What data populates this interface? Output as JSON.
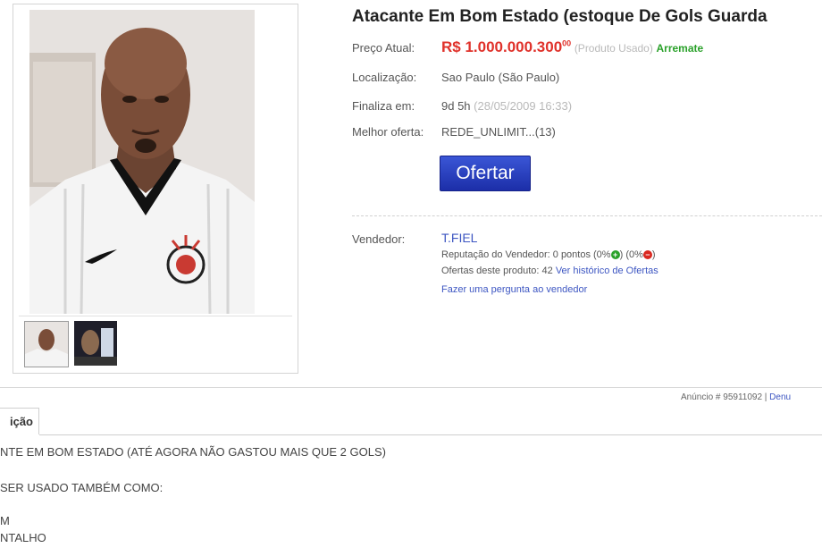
{
  "listing": {
    "title": "Atacante Em Bom Estado (estoque De Gols Guarda",
    "price_label": "Preço Atual:",
    "price": "R$ 1.000.000.300",
    "price_cents": "00",
    "condition": "(Produto Usado)",
    "auction_tag": "Arremate",
    "location_label": "Localização:",
    "location": "Sao Paulo (São Paulo)",
    "ends_label": "Finaliza em:",
    "ends_in": "9d 5h",
    "ends_date": "(28/05/2009 16:33)",
    "best_offer_label": "Melhor oferta:",
    "best_offer": "REDE_UNLIMIT...(13)",
    "offer_button": "Ofertar"
  },
  "seller": {
    "label": "Vendedor:",
    "name": "T.FIEL",
    "reputation_text": "Reputação do Vendedor: 0 pontos (0%",
    "reputation_mid": ")  (0%",
    "reputation_end": ")",
    "positive_icon": "plus-icon",
    "negative_icon": "minus-icon",
    "offers_text": "Ofertas deste produto: 42",
    "offers_link": "Ver histórico de Ofertas",
    "ask_link": "Fazer uma pergunta ao vendedor"
  },
  "ad": {
    "id_text": "Anúncio # 95911092 |",
    "report_link": "Denu"
  },
  "description": {
    "tab_label": "ição",
    "lines": [
      "NTE EM BOM ESTADO (ATÉ AGORA NÃO GASTOU MAIS QUE 2 GOLS)",
      "SER USADO TAMBÉM COMO:",
      "M",
      "NTALHO"
    ]
  },
  "colors": {
    "price": "#e0322b",
    "link": "#3d56c2",
    "button": "#2a40c0",
    "positive": "#2aa12a",
    "negative": "#d9271f"
  }
}
